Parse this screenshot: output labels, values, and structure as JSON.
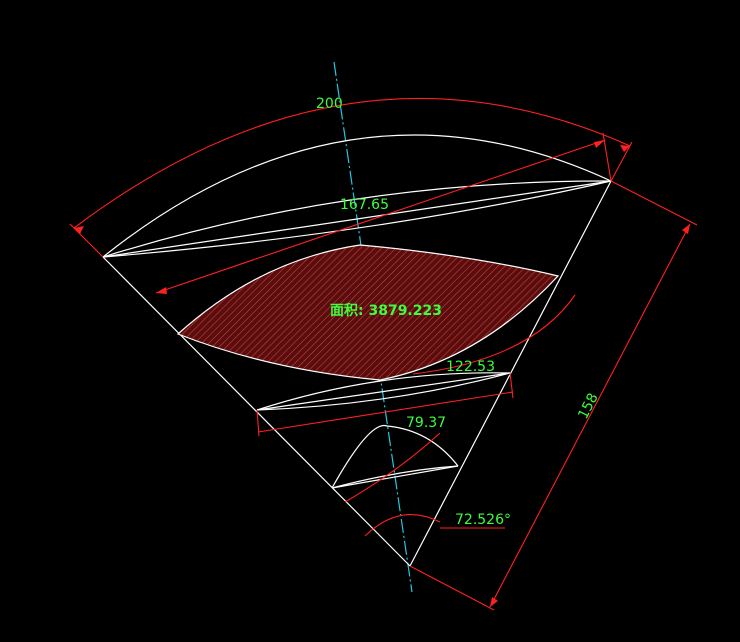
{
  "drawing": {
    "dimensions": {
      "arc_length": "200",
      "upper_chord": "167.65",
      "middle_chord": "122.53",
      "lower_chord": "79.37",
      "slant_length": "158",
      "angle": "72.526°"
    },
    "area_label": "面积: 3879.223"
  },
  "colors": {
    "background": "#000000",
    "geometry": "#ffffff",
    "dimension": "#ff2020",
    "dimension_text": "#3cff3c",
    "centerline": "#26c6e6",
    "hatch": "#7a1212"
  }
}
